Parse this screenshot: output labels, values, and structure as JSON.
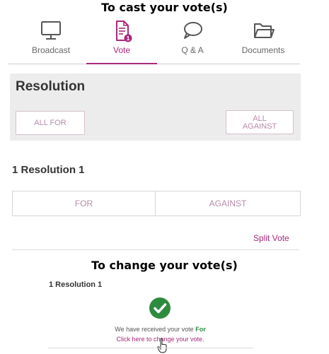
{
  "headings": {
    "cast": "To cast your vote(s)",
    "change": "To change your vote(s)"
  },
  "tabs": [
    {
      "label": "Broadcast",
      "icon": "monitor-icon",
      "active": false
    },
    {
      "label": "Vote",
      "icon": "ballot-document-icon",
      "active": true,
      "badge": "1"
    },
    {
      "label": "Q & A",
      "icon": "speech-bubble-icon",
      "active": false
    },
    {
      "label": "Documents",
      "icon": "folder-icon",
      "active": false
    }
  ],
  "resolution_panel": {
    "title": "Resolution",
    "all_for_label": "ALL FOR",
    "all_against_line1": "ALL",
    "all_against_line2": "AGAINST"
  },
  "resolution": {
    "heading": "1 Resolution 1",
    "for_label": "FOR",
    "against_label": "AGAINST",
    "split_vote_label": "Split Vote"
  },
  "confirmation": {
    "heading": "1 Resolution 1",
    "received_text": "We have received your vote",
    "vote_choice": "For",
    "change_link": "Click here to change your vote."
  },
  "colors": {
    "accent": "#a8287a",
    "button_text": "#b78aa9",
    "panel_bg": "#ececec",
    "success": "#2e8b3d"
  }
}
